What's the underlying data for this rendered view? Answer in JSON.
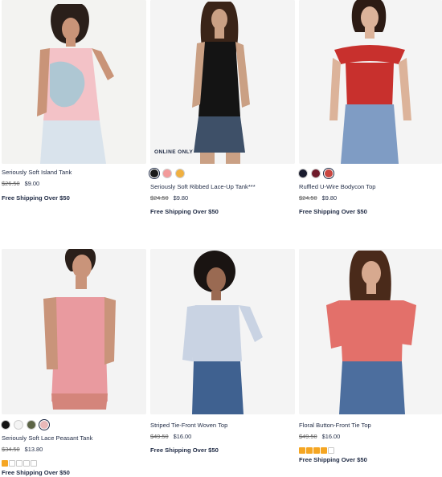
{
  "products": [
    {
      "name": "Seriously Soft Island Tank",
      "original_price": "$26.50",
      "sale_price": "$9.00",
      "shipping": "Free Shipping Over $50",
      "badge": "",
      "swatches": [],
      "rating": null
    },
    {
      "name": "Seriously Soft Ribbed Lace-Up Tank***",
      "original_price": "$24.50",
      "sale_price": "$9.80",
      "shipping": "Free Shipping Over $50",
      "badge": "ONLINE ONLY",
      "swatches": [
        "#1b1b1b",
        "#f29a9a",
        "#f0b040"
      ],
      "rating": null
    },
    {
      "name": "Ruffled U-Wire Bodycon Top",
      "original_price": "$24.50",
      "sale_price": "$9.80",
      "shipping": "Free Shipping Over $50",
      "badge": "",
      "swatches": [
        "#1a1c2e",
        "#6e1a2a",
        "#c9453f"
      ],
      "rating": null
    },
    {
      "name": "Seriously Soft Lace Peasant Tank",
      "original_price": "$34.50",
      "sale_price": "$13.80",
      "shipping": "Free Shipping Over $50",
      "badge": "",
      "swatches": [
        "#121212",
        "#f4f4f4",
        "#5c6446",
        "#e8b8b8"
      ],
      "rating": 1
    },
    {
      "name": "Striped Tie-Front Woven Top",
      "original_price": "$49.50",
      "sale_price": "$16.00",
      "shipping": "Free Shipping Over $50",
      "badge": "",
      "swatches": [],
      "rating": null
    },
    {
      "name": "Floral Button-Front Tie Top",
      "original_price": "$49.50",
      "sale_price": "$16.00",
      "shipping": "Free Shipping Over $50",
      "badge": "",
      "swatches": [],
      "rating": 4
    }
  ],
  "rating_max": 5
}
